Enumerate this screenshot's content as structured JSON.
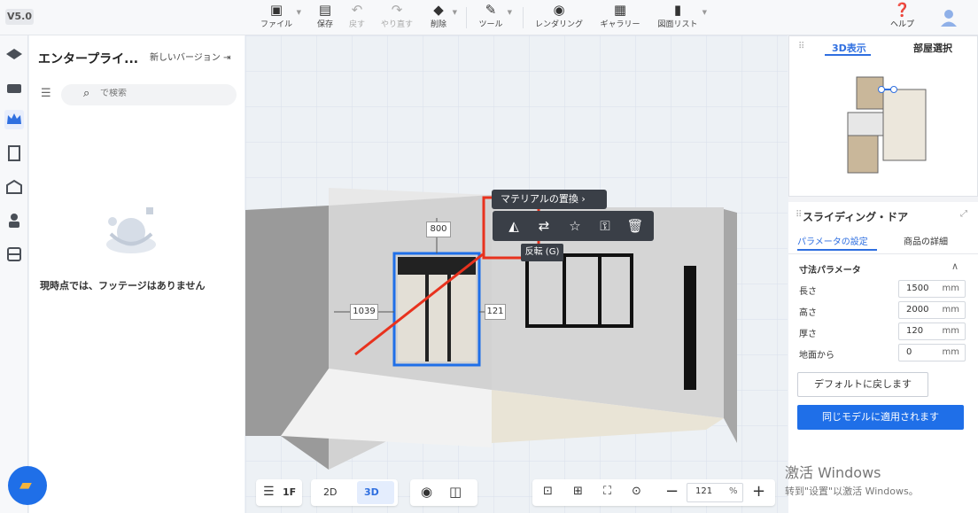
{
  "app": {
    "version": "V5.0"
  },
  "toolbar": {
    "file": "ファイル",
    "save": "保存",
    "undo": "戻す",
    "redo": "やり直す",
    "delete": "削除",
    "tools": "ツール",
    "render": "レンダリング",
    "gallery": "ギャラリー",
    "drawings": "図面リスト",
    "help": "ヘルプ"
  },
  "left_panel": {
    "title": "エンタープライ...",
    "new_version": "新しいバージョン",
    "search_placeholder": "で検索",
    "empty_message": "現時点では、フッテージはありません"
  },
  "viewport": {
    "material_replace": "マテリアルの置換",
    "tooltip": "反転 (G)",
    "dims": {
      "top": "800",
      "left": "1039",
      "right": "121"
    },
    "floor": "1F",
    "mode_2d": "2D",
    "mode_3d": "3D",
    "zoom": "121",
    "zoom_unit": "%"
  },
  "minimap": {
    "tab_3d": "3D表示",
    "tab_room": "部屋選択"
  },
  "properties": {
    "title": "スライディング・ドア",
    "tab_params": "パラメータの設定",
    "tab_details": "商品の詳細",
    "section": "寸法パラメータ",
    "rows": [
      {
        "label": "長さ",
        "value": "1500",
        "unit": "mm"
      },
      {
        "label": "高さ",
        "value": "2000",
        "unit": "mm"
      },
      {
        "label": "厚さ",
        "value": "120",
        "unit": "mm"
      },
      {
        "label": "地面から",
        "value": "0",
        "unit": "mm"
      }
    ],
    "reset_button": "デフォルトに戻します",
    "apply_button": "同じモデルに適用されます"
  },
  "watermark": {
    "line1": "激活 Windows",
    "line2": "转到\"设置\"以激活 Windows。"
  },
  "colors": {
    "accent": "#1f6fe8",
    "highlight": "#e8321e"
  }
}
